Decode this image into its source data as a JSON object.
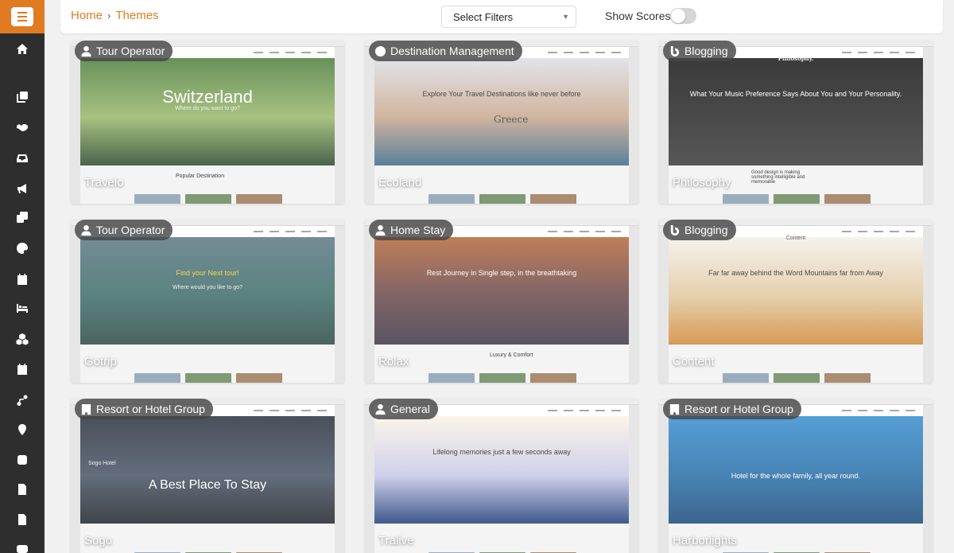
{
  "breadcrumb": {
    "home": "Home",
    "separator": "›",
    "current": "Themes"
  },
  "filters": {
    "placeholder": "Select Filters"
  },
  "scores": {
    "label": "Show Scores",
    "enabled": false
  },
  "sidebar": {
    "icons": [
      "menu-icon",
      "home-icon",
      "copy-icon",
      "handshake-icon",
      "inbox-icon",
      "megaphone-icon",
      "clone-icon",
      "palette-icon",
      "calendar-icon",
      "bed-icon",
      "cubes-icon",
      "calendar-grid-icon",
      "route-icon",
      "location-pin-icon",
      "blog-icon",
      "file-word-icon",
      "file-lines-icon",
      "youtube-icon"
    ],
    "accent": "#e07b22"
  },
  "themes": [
    {
      "category": "Tour Operator",
      "category_icon": "person-icon",
      "name": "Travelo",
      "hero_text": "Switzerland",
      "hero_sub": "Where do you want to go?",
      "lower_text": "Popular Destination",
      "hero_colors": [
        "#4f7f3f",
        "#9ab86d",
        "#2c4a2e"
      ]
    },
    {
      "category": "Destination Management",
      "category_icon": "globe-icon",
      "name": "Ecoland",
      "hero_text": "Explore Your Travel Destinations like never before",
      "hero_sub": "Greece",
      "hero_colors": [
        "#dde0e6",
        "#c9a98f",
        "#3f6b8a"
      ]
    },
    {
      "category": "Blogging",
      "category_icon": "blog-icon",
      "name": "Philosophy",
      "hero_text": "What Your Music Preference Says About You and Your Personality.",
      "hero_sub": "Philosophy.",
      "lower_text": "Good design is making something intelligible and memorable",
      "hero_colors": [
        "#1b1b1b",
        "#2c2c2c",
        "#3c3c3c"
      ]
    },
    {
      "category": "Tour Operator",
      "category_icon": "person-icon",
      "name": "Gotrip",
      "hero_text": "Find your Next tour!",
      "hero_sub": "Where would you like to go?",
      "hero_colors": [
        "#5d7a86",
        "#3f6e6a",
        "#2e4b46"
      ]
    },
    {
      "category": "Home Stay",
      "category_icon": "person-icon",
      "name": "Rolax",
      "hero_text": "Rest Journey in Single step, in the breathtaking",
      "lower_text": "Luxury & Comfort",
      "hero_colors": [
        "#b46a3e",
        "#6c4a4e",
        "#3e3a48"
      ]
    },
    {
      "category": "Blogging",
      "category_icon": "blog-icon",
      "name": "Content",
      "hero_text": "Far far away behind the Word Mountains far from Away",
      "hero_sub": "Content",
      "hero_colors": [
        "#f4f0ea",
        "#e2c9a0",
        "#d08a3a"
      ]
    },
    {
      "category": "Resort or Hotel Group",
      "category_icon": "hotel-icon",
      "name": "Sogo",
      "hero_text": "A Best Place To Stay",
      "hero_sub": "Sogo Hotel",
      "hero_colors": [
        "#2d3440",
        "#4a5566",
        "#22262e"
      ]
    },
    {
      "category": "General",
      "category_icon": "person-icon",
      "name": "Tralive",
      "hero_text": "Lifelong memories just a few seconds away",
      "hero_colors": [
        "#fbf3e6",
        "#c9c9e8",
        "#1f3f7a"
      ]
    },
    {
      "category": "Resort or Hotel Group",
      "category_icon": "hotel-icon",
      "name": "Harborlights",
      "hero_text": "Hotel for the whole family, all year round.",
      "hero_colors": [
        "#3a8fd0",
        "#2a6fa8",
        "#1c4d7c"
      ]
    }
  ]
}
